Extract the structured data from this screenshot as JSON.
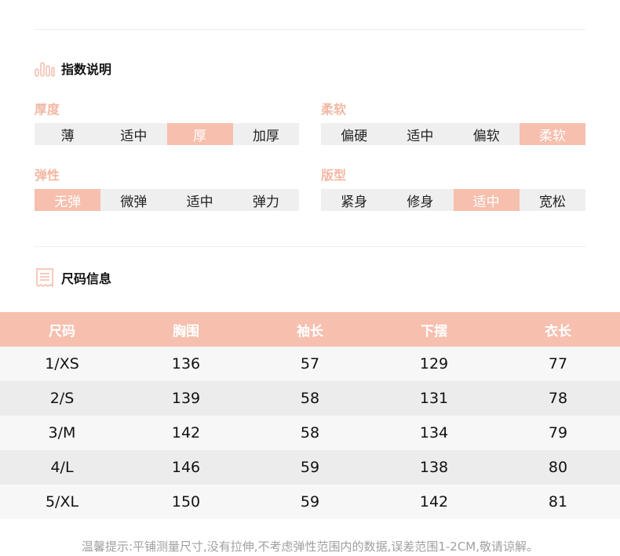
{
  "index_section": {
    "title": "指数说明",
    "groups": [
      {
        "label": "厚度",
        "options": [
          "薄",
          "适中",
          "厚",
          "加厚"
        ],
        "selected": 2
      },
      {
        "label": "柔软",
        "options": [
          "偏硬",
          "适中",
          "偏软",
          "柔软"
        ],
        "selected": 3
      },
      {
        "label": "弹性",
        "options": [
          "无弹",
          "微弹",
          "适中",
          "弹力"
        ],
        "selected": 0
      },
      {
        "label": "版型",
        "options": [
          "紧身",
          "修身",
          "适中",
          "宽松"
        ],
        "selected": 2
      }
    ]
  },
  "size_section": {
    "title": "尺码信息",
    "headers": [
      "尺码",
      "胸围",
      "袖长",
      "下摆",
      "衣长"
    ],
    "rows": [
      [
        "1/XS",
        "136",
        "57",
        "129",
        "77"
      ],
      [
        "2/S",
        "139",
        "58",
        "131",
        "78"
      ],
      [
        "3/M",
        "142",
        "58",
        "134",
        "79"
      ],
      [
        "4/L",
        "146",
        "59",
        "138",
        "80"
      ],
      [
        "5/XL",
        "150",
        "59",
        "142",
        "81"
      ]
    ]
  },
  "note": "温馨提示:平铺测量尺寸,没有拉伸,不考虑弹性范围内的数据,误差范围1-2CM,敬请谅解。",
  "colors": {
    "accent": "#f6bfae",
    "label": "#f3b7a3",
    "cell_bg": "#efefef"
  },
  "icons": {
    "index": "bar-chart-icon",
    "size": "receipt-icon"
  }
}
